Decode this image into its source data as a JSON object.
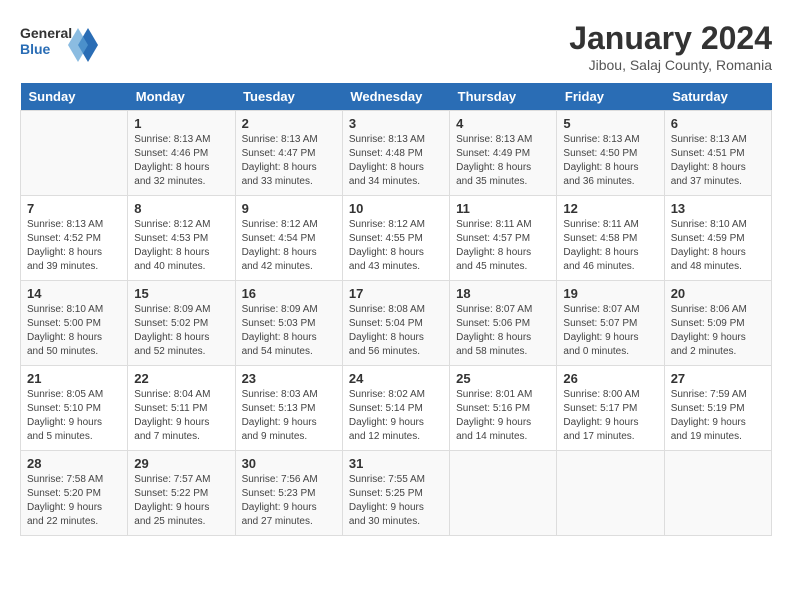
{
  "header": {
    "logo_line1": "General",
    "logo_line2": "Blue",
    "title": "January 2024",
    "subtitle": "Jibou, Salaj County, Romania"
  },
  "days_of_week": [
    "Sunday",
    "Monday",
    "Tuesday",
    "Wednesday",
    "Thursday",
    "Friday",
    "Saturday"
  ],
  "weeks": [
    [
      {
        "num": "",
        "info": ""
      },
      {
        "num": "1",
        "info": "Sunrise: 8:13 AM\nSunset: 4:46 PM\nDaylight: 8 hours\nand 32 minutes."
      },
      {
        "num": "2",
        "info": "Sunrise: 8:13 AM\nSunset: 4:47 PM\nDaylight: 8 hours\nand 33 minutes."
      },
      {
        "num": "3",
        "info": "Sunrise: 8:13 AM\nSunset: 4:48 PM\nDaylight: 8 hours\nand 34 minutes."
      },
      {
        "num": "4",
        "info": "Sunrise: 8:13 AM\nSunset: 4:49 PM\nDaylight: 8 hours\nand 35 minutes."
      },
      {
        "num": "5",
        "info": "Sunrise: 8:13 AM\nSunset: 4:50 PM\nDaylight: 8 hours\nand 36 minutes."
      },
      {
        "num": "6",
        "info": "Sunrise: 8:13 AM\nSunset: 4:51 PM\nDaylight: 8 hours\nand 37 minutes."
      }
    ],
    [
      {
        "num": "7",
        "info": "Sunrise: 8:13 AM\nSunset: 4:52 PM\nDaylight: 8 hours\nand 39 minutes."
      },
      {
        "num": "8",
        "info": "Sunrise: 8:12 AM\nSunset: 4:53 PM\nDaylight: 8 hours\nand 40 minutes."
      },
      {
        "num": "9",
        "info": "Sunrise: 8:12 AM\nSunset: 4:54 PM\nDaylight: 8 hours\nand 42 minutes."
      },
      {
        "num": "10",
        "info": "Sunrise: 8:12 AM\nSunset: 4:55 PM\nDaylight: 8 hours\nand 43 minutes."
      },
      {
        "num": "11",
        "info": "Sunrise: 8:11 AM\nSunset: 4:57 PM\nDaylight: 8 hours\nand 45 minutes."
      },
      {
        "num": "12",
        "info": "Sunrise: 8:11 AM\nSunset: 4:58 PM\nDaylight: 8 hours\nand 46 minutes."
      },
      {
        "num": "13",
        "info": "Sunrise: 8:10 AM\nSunset: 4:59 PM\nDaylight: 8 hours\nand 48 minutes."
      }
    ],
    [
      {
        "num": "14",
        "info": "Sunrise: 8:10 AM\nSunset: 5:00 PM\nDaylight: 8 hours\nand 50 minutes."
      },
      {
        "num": "15",
        "info": "Sunrise: 8:09 AM\nSunset: 5:02 PM\nDaylight: 8 hours\nand 52 minutes."
      },
      {
        "num": "16",
        "info": "Sunrise: 8:09 AM\nSunset: 5:03 PM\nDaylight: 8 hours\nand 54 minutes."
      },
      {
        "num": "17",
        "info": "Sunrise: 8:08 AM\nSunset: 5:04 PM\nDaylight: 8 hours\nand 56 minutes."
      },
      {
        "num": "18",
        "info": "Sunrise: 8:07 AM\nSunset: 5:06 PM\nDaylight: 8 hours\nand 58 minutes."
      },
      {
        "num": "19",
        "info": "Sunrise: 8:07 AM\nSunset: 5:07 PM\nDaylight: 9 hours\nand 0 minutes."
      },
      {
        "num": "20",
        "info": "Sunrise: 8:06 AM\nSunset: 5:09 PM\nDaylight: 9 hours\nand 2 minutes."
      }
    ],
    [
      {
        "num": "21",
        "info": "Sunrise: 8:05 AM\nSunset: 5:10 PM\nDaylight: 9 hours\nand 5 minutes."
      },
      {
        "num": "22",
        "info": "Sunrise: 8:04 AM\nSunset: 5:11 PM\nDaylight: 9 hours\nand 7 minutes."
      },
      {
        "num": "23",
        "info": "Sunrise: 8:03 AM\nSunset: 5:13 PM\nDaylight: 9 hours\nand 9 minutes."
      },
      {
        "num": "24",
        "info": "Sunrise: 8:02 AM\nSunset: 5:14 PM\nDaylight: 9 hours\nand 12 minutes."
      },
      {
        "num": "25",
        "info": "Sunrise: 8:01 AM\nSunset: 5:16 PM\nDaylight: 9 hours\nand 14 minutes."
      },
      {
        "num": "26",
        "info": "Sunrise: 8:00 AM\nSunset: 5:17 PM\nDaylight: 9 hours\nand 17 minutes."
      },
      {
        "num": "27",
        "info": "Sunrise: 7:59 AM\nSunset: 5:19 PM\nDaylight: 9 hours\nand 19 minutes."
      }
    ],
    [
      {
        "num": "28",
        "info": "Sunrise: 7:58 AM\nSunset: 5:20 PM\nDaylight: 9 hours\nand 22 minutes."
      },
      {
        "num": "29",
        "info": "Sunrise: 7:57 AM\nSunset: 5:22 PM\nDaylight: 9 hours\nand 25 minutes."
      },
      {
        "num": "30",
        "info": "Sunrise: 7:56 AM\nSunset: 5:23 PM\nDaylight: 9 hours\nand 27 minutes."
      },
      {
        "num": "31",
        "info": "Sunrise: 7:55 AM\nSunset: 5:25 PM\nDaylight: 9 hours\nand 30 minutes."
      },
      {
        "num": "",
        "info": ""
      },
      {
        "num": "",
        "info": ""
      },
      {
        "num": "",
        "info": ""
      }
    ]
  ]
}
